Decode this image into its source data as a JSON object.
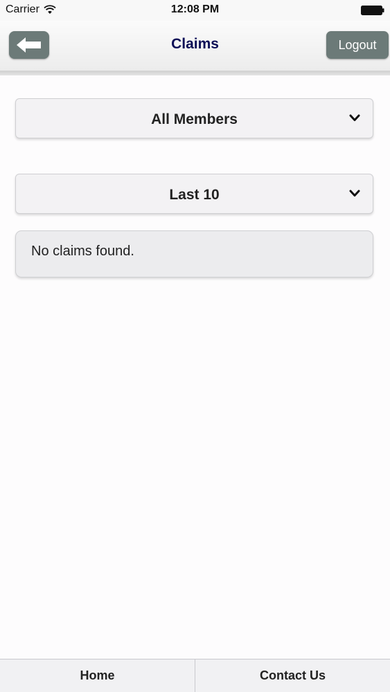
{
  "status_bar": {
    "carrier": "Carrier",
    "time": "12:08 PM"
  },
  "header": {
    "title": "Claims",
    "logout_label": "Logout",
    "back_icon": "back-arrow-icon"
  },
  "filters": {
    "members_selected": "All Members",
    "period_selected": "Last 10"
  },
  "results": {
    "message": "No claims found."
  },
  "footer": {
    "items": [
      {
        "label": "Home"
      },
      {
        "label": "Contact Us"
      }
    ]
  },
  "colors": {
    "title": "#0c0e56",
    "button_bg": "#6c7a78",
    "panel_bg": "#f3f2f4"
  }
}
